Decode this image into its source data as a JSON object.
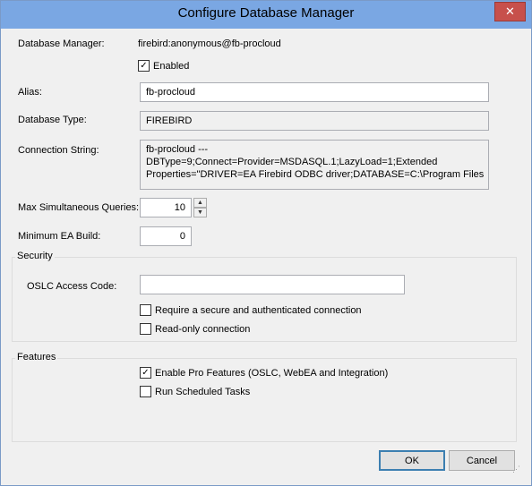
{
  "window": {
    "title": "Configure Database Manager",
    "close_glyph": "✕"
  },
  "fields": {
    "database_manager_label": "Database Manager:",
    "database_manager_value": "firebird:anonymous@fb-procloud",
    "enabled_label": "Enabled",
    "enabled_checked": true,
    "alias_label": "Alias:",
    "alias_value": "fb-procloud",
    "database_type_label": "Database Type:",
    "database_type_value": "FIREBIRD",
    "connection_string_label": "Connection String:",
    "connection_string_value": "fb-procloud ---\nDBType=9;Connect=Provider=MSDASQL.1;LazyLoad=1;Extended\nProperties=\"DRIVER=EA Firebird ODBC driver;DATABASE=C:\\Program Files",
    "max_queries_label": "Max Simultaneous Queries:",
    "max_queries_value": "10",
    "min_ea_build_label": "Minimum EA Build:",
    "min_ea_build_value": "0"
  },
  "security": {
    "group_label": "Security",
    "oslc_label": "OSLC Access Code:",
    "oslc_value": "",
    "require_secure_label": "Require a secure and authenticated connection",
    "require_secure_checked": false,
    "readonly_label": "Read-only connection",
    "readonly_checked": false
  },
  "features": {
    "group_label": "Features",
    "pro_features_label": "Enable Pro Features (OSLC, WebEA and Integration)",
    "pro_features_checked": true,
    "run_scheduled_label": "Run Scheduled Tasks",
    "run_scheduled_checked": false
  },
  "buttons": {
    "ok_label": "OK",
    "cancel_label": "Cancel"
  },
  "icons": {
    "close": "close-icon",
    "spin_up": "chevron-up-icon",
    "spin_down": "chevron-down-icon",
    "check": "checkmark-icon",
    "grip": "resize-grip-icon"
  },
  "colors": {
    "titlebar": "#7aa7e3",
    "close_button": "#c7504b",
    "dialog_bg": "#f0f0f0",
    "default_button_border": "#3c7fb1"
  }
}
